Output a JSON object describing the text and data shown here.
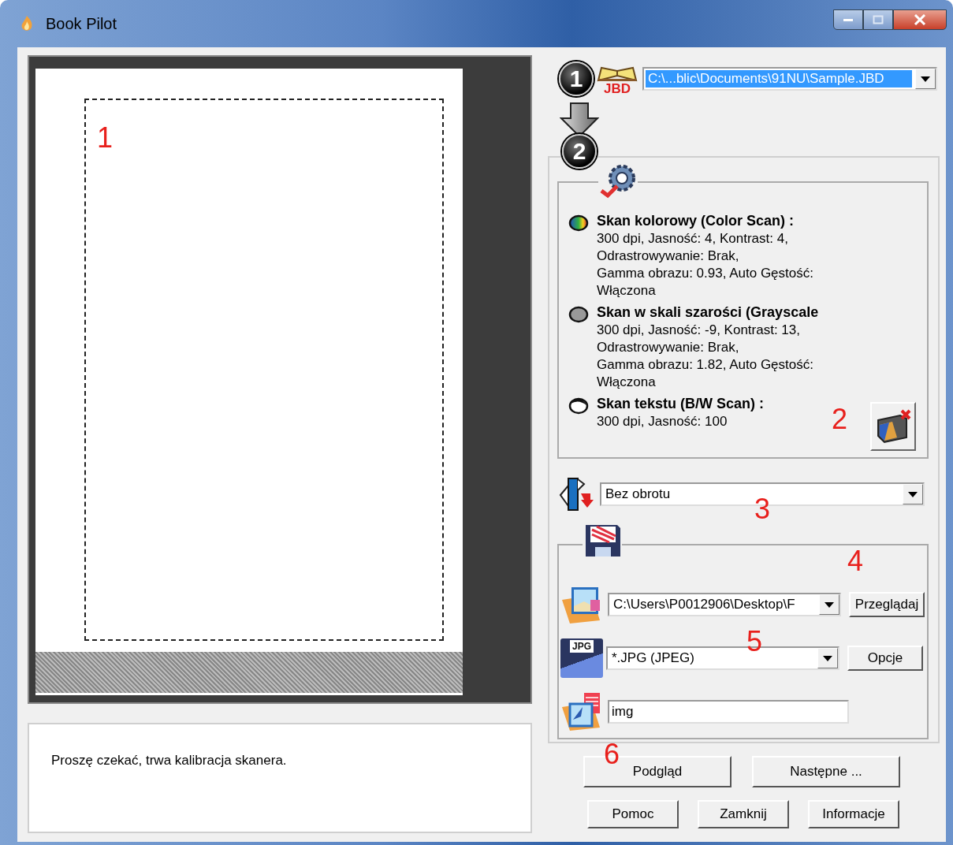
{
  "window": {
    "title": "Book Pilot"
  },
  "preview": {
    "annotation": "1"
  },
  "status": {
    "message": "Proszę czekać, trwa kalibracja skanera."
  },
  "step1": {
    "badge": "1",
    "icon_label": "JBD",
    "file": {
      "value": "C:\\...blic\\Documents\\91NU\\Sample.JBD",
      "selected": true
    }
  },
  "step2": {
    "badge": "2",
    "annotation": "2",
    "scan_modes": [
      {
        "kind": "color",
        "title": "Skan kolorowy (Color Scan) :",
        "details": [
          "300 dpi,  Jasność: 4,  Kontrast: 4,",
          "Odrastrowywanie: Brak,",
          "Gamma obrazu: 0.93,  Auto Gęstość:",
          "Włączona"
        ]
      },
      {
        "kind": "grayscale",
        "title": "Skan w skali szarości (Grayscale",
        "details": [
          "300 dpi,  Jasność: -9,  Kontrast: 13,",
          "Odrastrowywanie: Brak,",
          "Gamma obrazu: 1.82,  Auto Gęstość:",
          "Włączona"
        ]
      },
      {
        "kind": "bw",
        "title": "Skan tekstu (B/W Scan) :",
        "details": [
          "300 dpi,  Jasność: 100"
        ]
      }
    ]
  },
  "rotation": {
    "value": "Bez obrotu",
    "annotation": "3"
  },
  "output": {
    "folder": {
      "value": "C:\\Users\\P0012906\\Desktop\\F",
      "annotation": "4"
    },
    "browse_button": "Przeglądaj",
    "format": {
      "value": "*.JPG (JPEG)",
      "annotation": "5"
    },
    "format_icon_label": "JPG",
    "options_button": "Opcje",
    "filename": {
      "value": "img"
    }
  },
  "buttons": [
    {
      "label": "Podgląd",
      "annotation": "6"
    },
    {
      "label": "Następne ..."
    }
  ],
  "bottom_buttons": [
    "Pomoc",
    "Zamknij",
    "Informacje"
  ]
}
